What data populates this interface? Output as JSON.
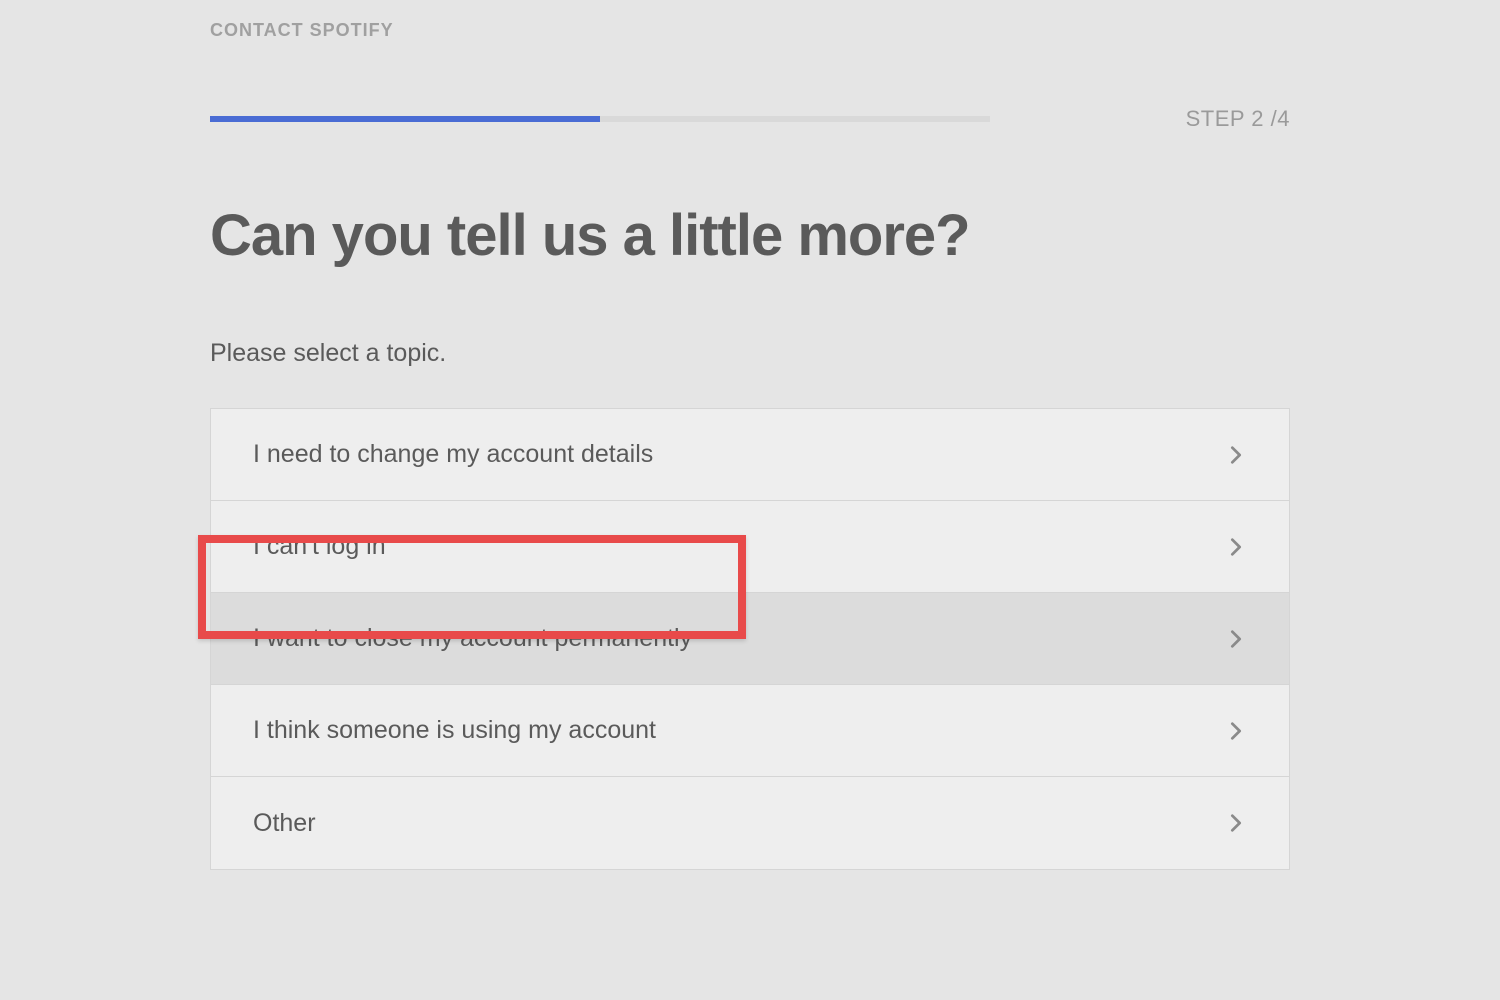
{
  "breadcrumb": "CONTACT SPOTIFY",
  "step_label": "STEP 2 /4",
  "heading": "Can you tell us a little more?",
  "subheading": "Please select a topic.",
  "options": [
    {
      "label": "I need to change my account details"
    },
    {
      "label": "I can't log in"
    },
    {
      "label": "I want to close my account permanently"
    },
    {
      "label": "I think someone is using my account"
    },
    {
      "label": "Other"
    }
  ],
  "progress": {
    "percent": 50
  },
  "highlighted_option_index": 2
}
